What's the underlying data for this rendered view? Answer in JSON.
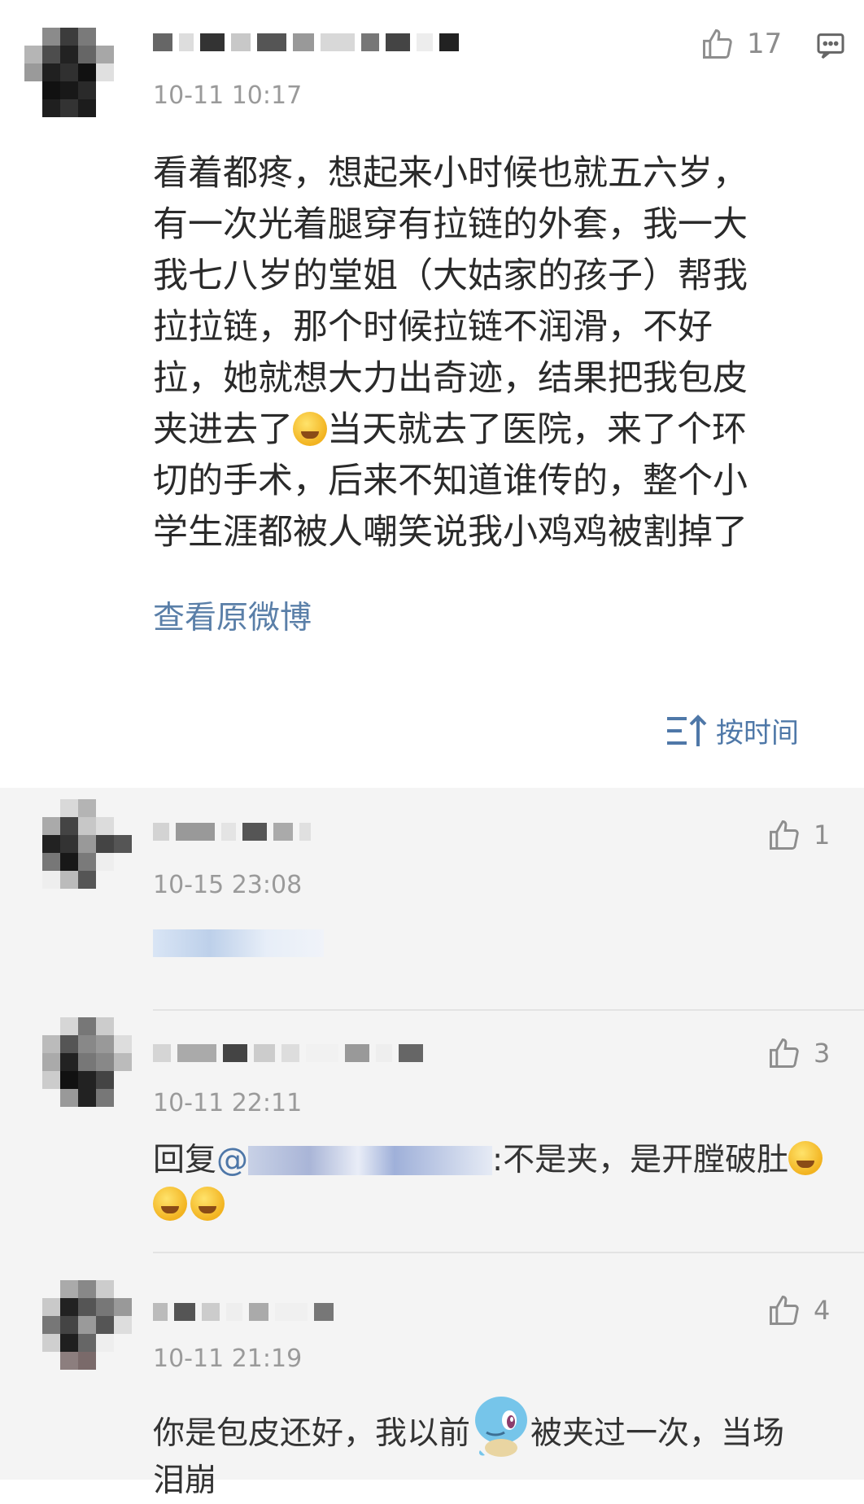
{
  "main_comment": {
    "timestamp": "10-11 10:17",
    "likes": "17",
    "text_lines": [
      "看着都疼，想起来小时候也就五六岁，",
      "有一次光着腿穿有拉链的外套，我一大",
      "我七八岁的堂姐（大姑家的孩子）帮我",
      "拉拉链，那个时候拉链不润滑，不好",
      "拉，她就想大力出奇迹，结果把我包皮",
      "夹进去了",
      "当天就去了医院，来了个环",
      "切的手术，后来不知道谁传的，整个小",
      "学生涯都被人嘲笑说我小鸡鸡被割掉了"
    ],
    "view_original": "查看原微博"
  },
  "sort_label": "按时间",
  "replies": [
    {
      "timestamp": "10-15 23:08",
      "likes": "1"
    },
    {
      "timestamp": "10-11 22:11",
      "likes": "3",
      "reply_prefix": "回复",
      "at_symbol": "@",
      "reply_text": ":不是夹，是开膛破肚"
    },
    {
      "timestamp": "10-11 21:19",
      "likes": "4",
      "text_part1": "你是包皮还好，我以前",
      "text_part2": "被夹过一次，当场",
      "text_line2": "泪崩"
    }
  ],
  "icons": {
    "like": "thumbs-up-icon",
    "comment": "comment-icon",
    "sort": "sort-icon",
    "emoji": "laugh-cry-emoji",
    "sticker": "squirtle-sticker-icon"
  },
  "colors": {
    "link": "#5a7fa8",
    "timestamp": "#9a9a9a",
    "background_reply": "#f4f4f4"
  }
}
